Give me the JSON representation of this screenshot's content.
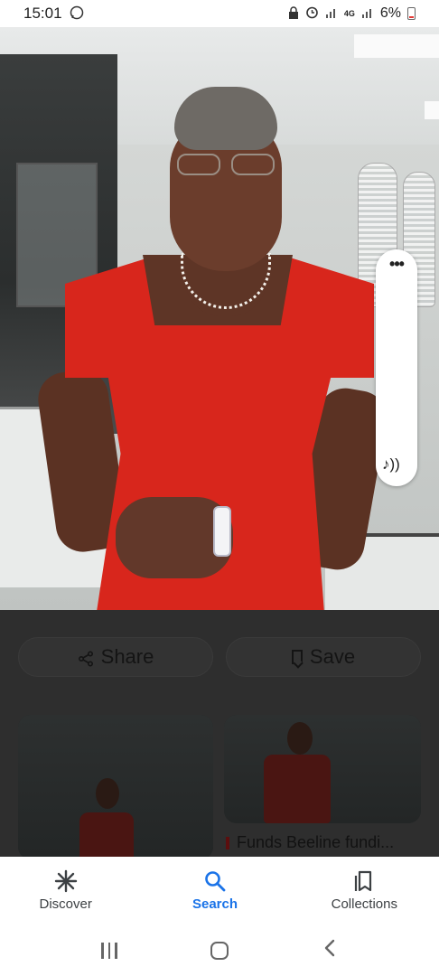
{
  "status_bar": {
    "time": "15:01",
    "network_label": "4G",
    "battery_text": "6%"
  },
  "audio_widget": {
    "more_label": "•••",
    "note_glyph": "♪))"
  },
  "actions": {
    "share_label": "Share",
    "save_label": "Save"
  },
  "related": {
    "caption": "Funds Beeline fundi..."
  },
  "bottom_nav": {
    "items": [
      {
        "label": "Discover",
        "icon": "asterisk-icon"
      },
      {
        "label": "Search",
        "icon": "search-icon"
      },
      {
        "label": "Collections",
        "icon": "collections-icon"
      }
    ],
    "active": "Search"
  },
  "colors": {
    "active_blue": "#1a73e8",
    "dress_red": "#d8261c",
    "overlay_dark": "#2e2e2e"
  }
}
